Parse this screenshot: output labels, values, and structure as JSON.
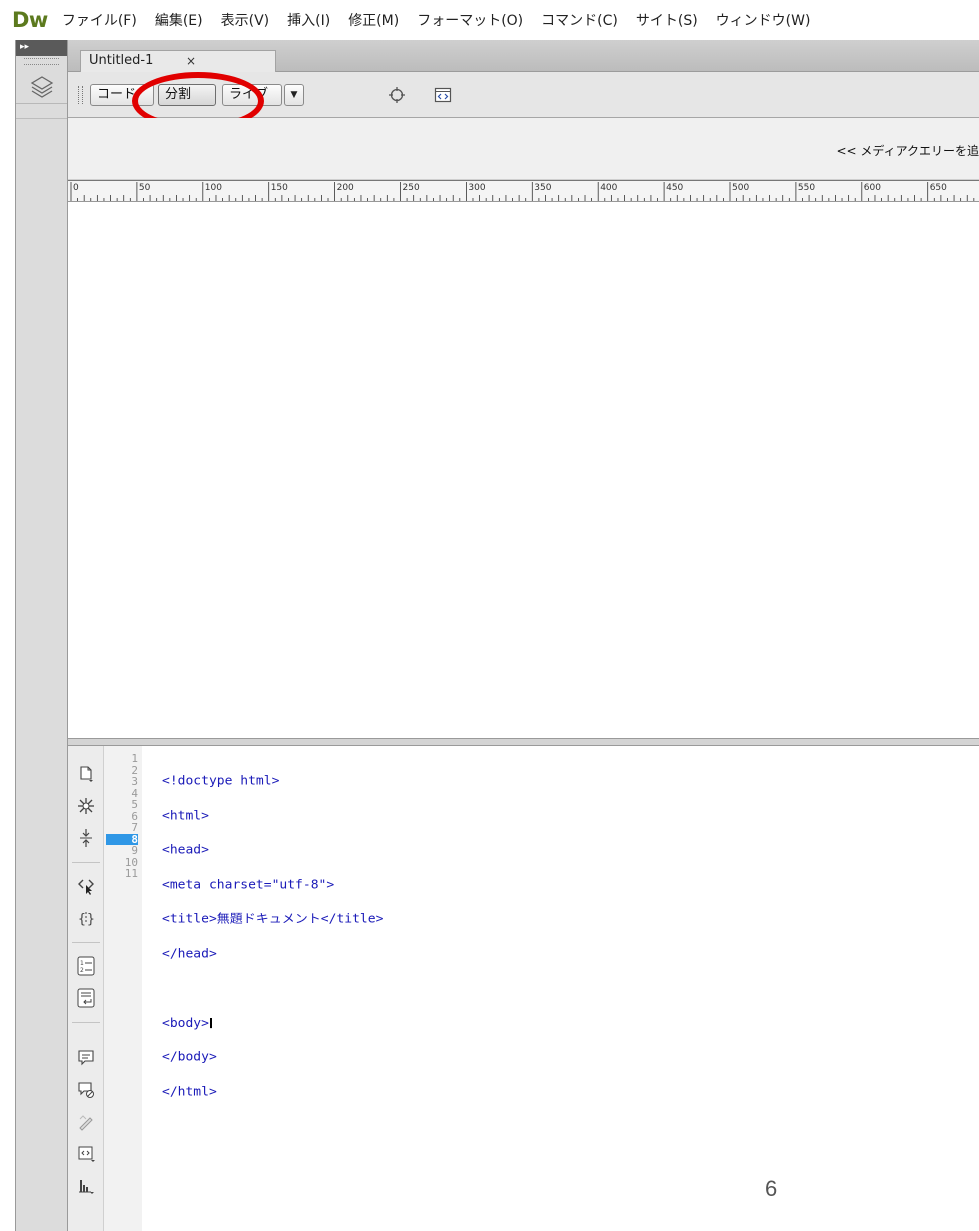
{
  "app": {
    "logo": "Dw",
    "menu": [
      "ファイル(F)",
      "編集(E)",
      "表示(V)",
      "挿入(I)",
      "修正(M)",
      "フォーマット(O)",
      "コマンド(C)",
      "サイト(S)",
      "ウィンドウ(W)"
    ]
  },
  "left_panel": {
    "collapse_glyph": "▸▸"
  },
  "document_tab": {
    "title": "Untitled-1",
    "close": "×"
  },
  "toolbar": {
    "code_label": "コード",
    "split_label": "分割",
    "live_label": "ライブ",
    "dropdown_glyph": "▼"
  },
  "media_query": {
    "label": "<< メディアクエリーを追"
  },
  "ruler": {
    "ticks": [
      "0",
      "50",
      "100",
      "150",
      "200",
      "250",
      "300",
      "350",
      "400",
      "450",
      "500",
      "550",
      "600",
      "650"
    ]
  },
  "code_view": {
    "line_numbers": [
      "1",
      "2",
      "3",
      "4",
      "5",
      "6",
      "7",
      "8",
      "9",
      "10",
      "11"
    ],
    "active_line": 8,
    "lines": [
      "<!doctype html>",
      "<html>",
      "<head>",
      "<meta charset=\"utf-8\">",
      "<title>無題ドキュメント</title>",
      "</head>",
      "",
      "<body>",
      "</body>",
      "</html>",
      ""
    ]
  },
  "slide": {
    "page_number": "6"
  },
  "colors": {
    "logo": "#5c7a1e",
    "highlight_circle": "#e10000",
    "active_line": "#2f97e6",
    "code_tag": "#1a1ab8"
  }
}
